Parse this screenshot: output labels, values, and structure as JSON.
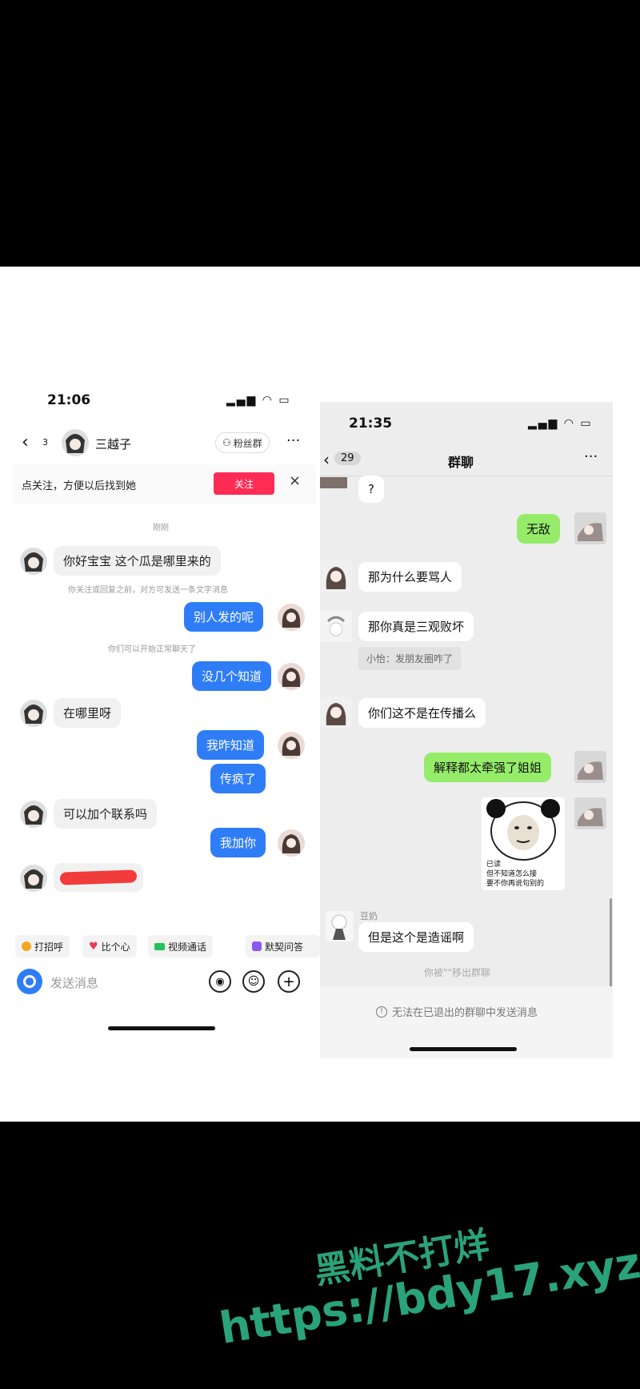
{
  "left": {
    "status_time": "21:06",
    "nav": {
      "back_count": "3",
      "contact_name": "三越子",
      "fans_group": "粉丝群",
      "more": "···"
    },
    "follow_banner": {
      "text": "点关注，方便以后找到她",
      "button": "关注",
      "close": "×"
    },
    "timestamp": "刚刚",
    "messages": [
      {
        "side": "in",
        "text": "你好宝宝 这个瓜是哪里来的"
      },
      {
        "side": "out",
        "text": "别人发的呢"
      },
      {
        "side": "out",
        "text": "没几个知道"
      },
      {
        "side": "in",
        "text": "在哪里呀"
      },
      {
        "side": "out",
        "text": "我昨知道"
      },
      {
        "side": "out",
        "text": "传疯了"
      },
      {
        "side": "in",
        "text": "可以加个联系吗"
      },
      {
        "side": "out",
        "text": "我加你"
      }
    ],
    "system_notes": [
      "你关注或回复之前，对方可发送一条文字消息",
      "你们可以开始正常聊天了"
    ],
    "quick_actions": [
      "打招呼",
      "比个心",
      "视频通话",
      "默契问答"
    ],
    "input_placeholder": "发送消息"
  },
  "right": {
    "status_time": "21:35",
    "nav": {
      "back_count": "29",
      "title": "群聊",
      "more": "···"
    },
    "messages": [
      {
        "side": "in",
        "text": "?"
      },
      {
        "side": "out",
        "text": "无敌"
      },
      {
        "side": "in",
        "text": "那为什么要骂人"
      },
      {
        "side": "in",
        "text": "那你真是三观败坏",
        "quote": "小怡：发朋友圈咋了"
      },
      {
        "side": "in",
        "text": "你们这不是在传播么"
      },
      {
        "side": "out",
        "text": "解释都太牵强了姐姐"
      },
      {
        "side": "in",
        "sender": "豆奶",
        "text": "但是这个是造谣啊"
      }
    ],
    "meme_caption": [
      "已读",
      "但不知道怎么接",
      "要不你再说句别的"
    ],
    "removed_note": "你被\"\"移出群聊",
    "footer_note": "无法在已退出的群聊中发送消息"
  },
  "watermark": {
    "line1": "黑料不打烊",
    "line2": "https://bdy17.xyz",
    "color": "#2aa37a"
  }
}
